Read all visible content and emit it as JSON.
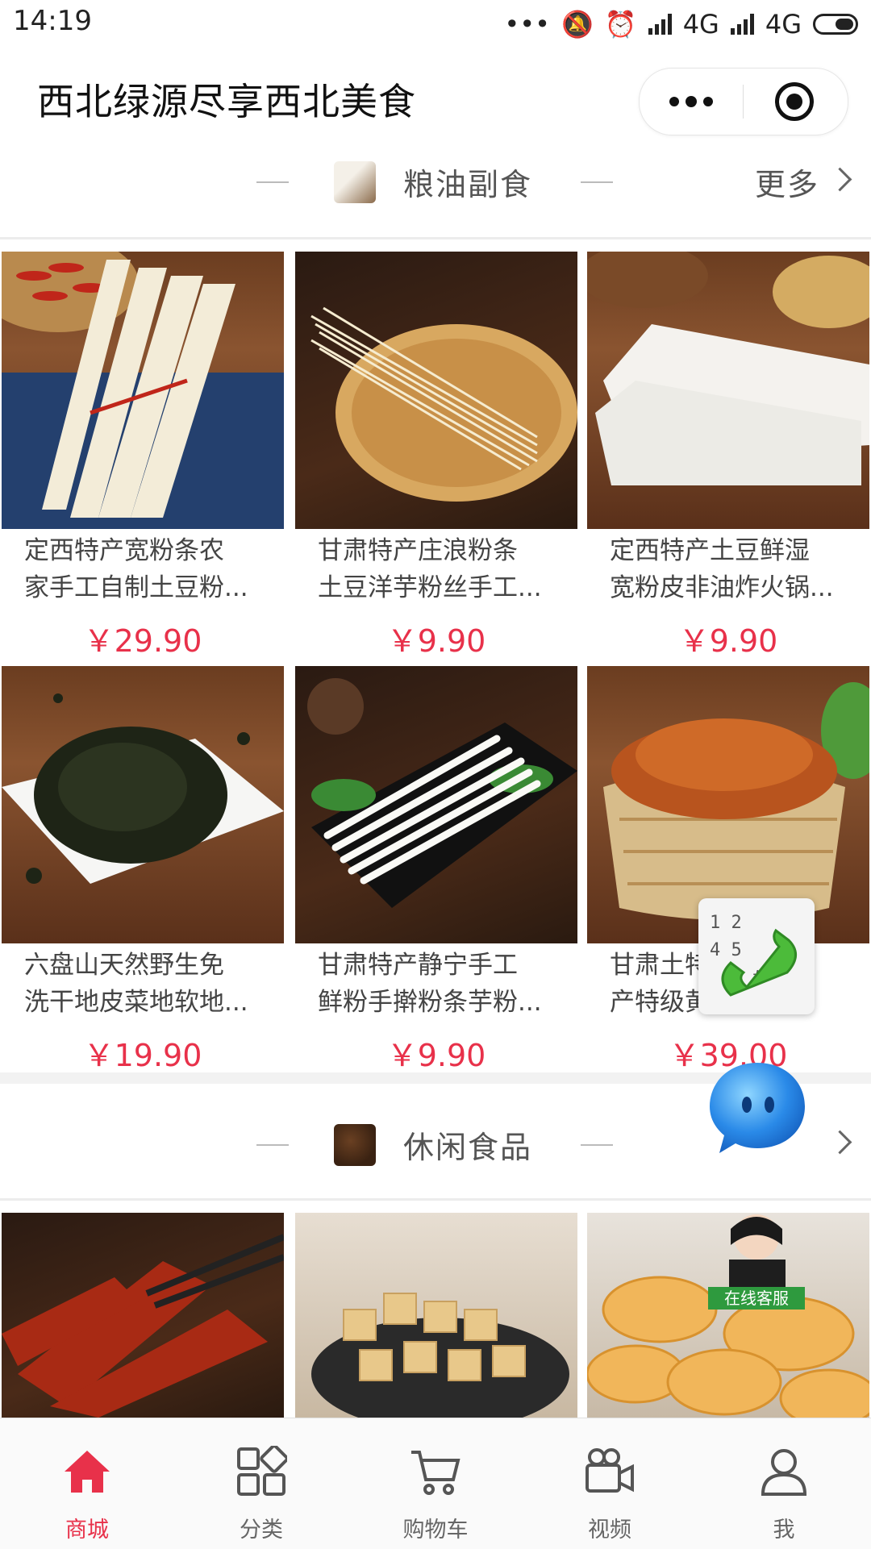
{
  "status_bar": {
    "time": "14:19",
    "network1": "4G",
    "network2": "4G"
  },
  "navbar": {
    "title": "西北绿源尽享西北美食"
  },
  "colors": {
    "accent": "#e8314a",
    "text": "#444444"
  },
  "sections": [
    {
      "title": "粮油副食",
      "more": "更多",
      "products": [
        {
          "name1": "定西特产宽粉条农",
          "name2": "家手工自制土豆粉...",
          "price": "￥29.90"
        },
        {
          "name1": "甘肃特产庄浪粉条",
          "name2": "土豆洋芋粉丝手工...",
          "price": "￥9.90"
        },
        {
          "name1": "定西特产土豆鲜湿",
          "name2": "宽粉皮非油炸火锅...",
          "price": "￥9.90"
        },
        {
          "name1": "六盘山天然野生免",
          "name2": "洗干地皮菜地软地...",
          "price": "￥19.90"
        },
        {
          "name1": "甘肃特产静宁手工",
          "name2": "鲜粉手擀粉条芋粉...",
          "price": "￥9.90"
        },
        {
          "name1": "甘肃土特",
          "name2": "产特级黄",
          "price": "￥39.00"
        }
      ]
    },
    {
      "title": "休闲食品",
      "more": ""
    }
  ],
  "floating": {
    "service_label": "在线客服",
    "keypad": "1 2\n4 5\n    #"
  },
  "tabbar": [
    {
      "label": "商城",
      "icon": "home-icon",
      "active": true
    },
    {
      "label": "分类",
      "icon": "category-icon",
      "active": false
    },
    {
      "label": "购物车",
      "icon": "cart-icon",
      "active": false
    },
    {
      "label": "视频",
      "icon": "video-icon",
      "active": false
    },
    {
      "label": "我",
      "icon": "profile-icon",
      "active": false
    }
  ]
}
